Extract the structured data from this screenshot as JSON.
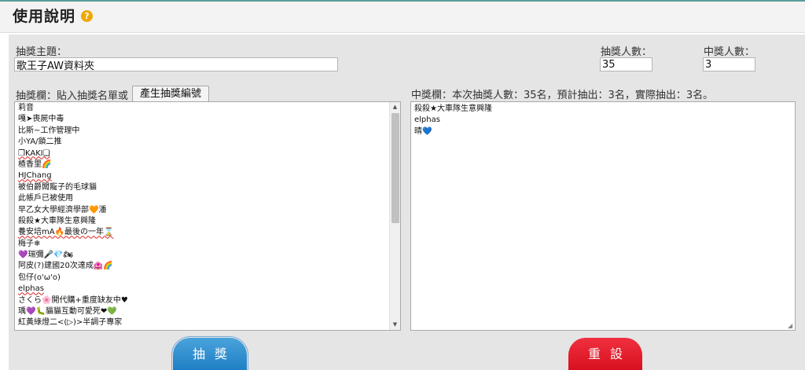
{
  "header": {
    "title": "使用說明",
    "help_icon": "?"
  },
  "topic": {
    "label": "抽獎主題：",
    "value": "歌王子AW資料夾"
  },
  "participants_count": {
    "label": "抽獎人數：",
    "value": "35"
  },
  "winners_count": {
    "label": "中獎人數：",
    "value": "3"
  },
  "draw_list": {
    "label": "抽獎欄：貼入抽獎名單或",
    "generate_button": "產生抽獎編號",
    "entries": [
      "莉音",
      "嘎➤喪屍中毒",
      "比斯~工作管理中",
      "小YA/鎖二推",
      "❐KAKI❏",
      "楂香里🌈",
      "HJChang",
      "被伯爵闆寵子的毛球貓",
      "此帳戶已被使用",
      "早乙女大學經濟學部🧡潘",
      "殺殺★大車隊生意興隆",
      "養安培mA🔥最後の一年⌛",
      "梅子❄",
      "💜瑞彌🎤💎🏍",
      "阿皮(?)建國20次達成🏩🌈",
      "包仔(o'ω'o)",
      "elphas",
      "さくら🌸開代購+重度缺友中♥",
      "瑀💜🐛貓貓互動可愛死❤💚",
      "紅黃綠燈二<(▷)>半調子專家"
    ]
  },
  "winners": {
    "label": "中獎欄：本次抽獎人數：35名，預計抽出：3名，實際抽出：3名。",
    "entries": [
      "殺殺★大車隊生意興隆",
      "elphas",
      "晴💙"
    ]
  },
  "buttons": {
    "draw": "抽獎",
    "reset": "重設"
  },
  "colors": {
    "draw_button": "#2a8ad0",
    "reset_button": "#e41d2d",
    "help_icon": "#f0a800"
  }
}
